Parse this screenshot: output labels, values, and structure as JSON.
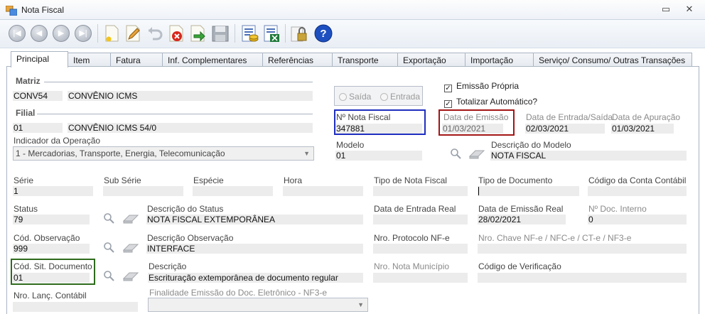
{
  "window": {
    "title": "Nota Fiscal",
    "minimize_glyph": "▭",
    "close_glyph": "✕"
  },
  "toolbar": {
    "buttons": [
      "first-record-icon",
      "previous-record-icon",
      "next-record-icon",
      "last-record-icon",
      "new-document-icon",
      "edit-pencil-icon",
      "undo-icon",
      "delete-icon",
      "save-arrow-icon",
      "floppy-save-icon",
      "calculate-values-icon",
      "excel-export-icon",
      "lock-icon",
      "help-icon"
    ]
  },
  "tabs": [
    "Principal",
    "Item",
    "Fatura",
    "Inf. Complementares",
    "Referências",
    "Transporte",
    "Exportação",
    "Importação",
    "Serviço/ Consumo/ Outras Transações"
  ],
  "matriz": {
    "label": "Matriz",
    "code": "CONV54",
    "name": "CONVÊNIO ICMS"
  },
  "filial": {
    "label": "Filial",
    "code": "01",
    "name": "CONVÊNIO ICMS 54/0"
  },
  "indicador": {
    "label": "Indicador da Operação",
    "value": "1 - Mercadorias, Transporte, Energia, Telecomunicação"
  },
  "tipo_operacao": {
    "saida": "Saída",
    "entrada": "Entrada"
  },
  "emissao_propria": {
    "label": "Emissão Própria",
    "checked": true
  },
  "totalizar": {
    "label": "Totalizar Automático?",
    "checked": true
  },
  "nota": {
    "label": "Nº Nota Fiscal",
    "value": "347881"
  },
  "data_emissao": {
    "label": "Data de Emissão",
    "value": "01/03/2021"
  },
  "data_entrada_saida": {
    "label": "Data de Entrada/Saída",
    "value": "02/03/2021"
  },
  "data_apuracao": {
    "label": "Data de Apuração",
    "value": "01/03/2021"
  },
  "modelo": {
    "label": "Modelo",
    "value": "01"
  },
  "desc_modelo": {
    "label": "Descrição do Modelo",
    "value": "NOTA FISCAL"
  },
  "row1": {
    "serie": {
      "label": "Série",
      "value": "1"
    },
    "sub_serie": {
      "label": "Sub Série",
      "value": ""
    },
    "especie": {
      "label": "Espécie",
      "value": ""
    },
    "hora": {
      "label": "Hora",
      "value": ""
    },
    "tipo_nf": {
      "label": "Tipo de Nota Fiscal",
      "value": ""
    },
    "tipo_doc": {
      "label": "Tipo de Documento",
      "value": ""
    },
    "conta_contabil": {
      "label": "Código da Conta Contábil",
      "value": ""
    }
  },
  "status": {
    "label": "Status",
    "value": "79"
  },
  "desc_status": {
    "label": "Descrição do Status",
    "value": "NOTA FISCAL EXTEMPORÂNEA"
  },
  "data_entrada_real": {
    "label": "Data de Entrada Real",
    "value": ""
  },
  "data_emissao_real": {
    "label": "Data de Emissão Real",
    "value": "28/02/2021"
  },
  "doc_interno": {
    "label": "Nº Doc. Interno",
    "value": "0"
  },
  "cod_obs": {
    "label": "Cód. Observação",
    "value": "999"
  },
  "desc_obs": {
    "label": "Descrição Observação",
    "value": "INTERFACE"
  },
  "protocolo": {
    "label": "Nro. Protocolo NF-e",
    "value": ""
  },
  "chave": {
    "label": "Nro. Chave NF-e / NFC-e / CT-e / NF3-e",
    "value": ""
  },
  "cod_sit": {
    "label": "Cód. Sit. Documento",
    "value": "01"
  },
  "descricao": {
    "label": "Descrição",
    "value": "Escrituração extemporânea de documento regular"
  },
  "nota_municipio": {
    "label": "Nro. Nota Município",
    "value": ""
  },
  "cod_verificacao": {
    "label": "Código de Verificação",
    "value": ""
  },
  "lanc_contabil": {
    "label": "Nro. Lanç. Contábil",
    "value": ""
  },
  "finalidade": {
    "label": "Finalidade Emissão do Doc. Eletrônico - NF3-e",
    "value": ""
  },
  "highlight_colors": {
    "nota": "#1f2fbf",
    "data_emissao": "#a31515",
    "cod_sit": "#2e6b1d"
  }
}
